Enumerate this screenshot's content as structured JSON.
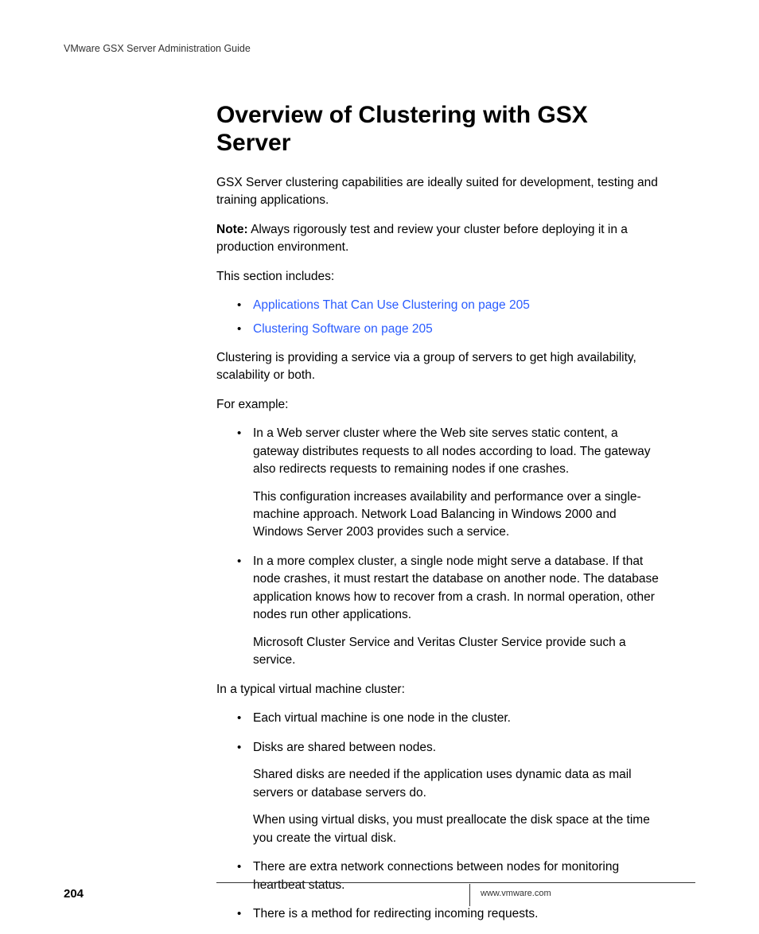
{
  "header": {
    "doc_title": "VMware GSX Server Administration Guide"
  },
  "main": {
    "heading": "Overview of Clustering with GSX Server",
    "intro": "GSX Server clustering capabilities are ideally suited for development, testing and training applications.",
    "note_label": "Note:",
    "note_text": "Always rigorously test and review your cluster before deploying it in a production environment.",
    "section_includes": "This section includes:",
    "links": [
      "Applications That Can Use Clustering on page 205",
      "Clustering Software on page 205"
    ],
    "clustering_def": "Clustering is providing a service via a group of servers to get high availability, scalability or both.",
    "for_example": "For example:",
    "examples": [
      {
        "main": "In a Web server cluster where the Web site serves static content, a gateway distributes requests to all nodes according to load. The gateway also redirects requests to remaining nodes if one crashes.",
        "sub": "This configuration increases availability and performance over a single-machine approach. Network Load Balancing in Windows 2000 and Windows Server 2003 provides such a service."
      },
      {
        "main": "In a more complex cluster, a single node might serve a database. If that node crashes, it must restart the database on another node. The database application knows how to recover from a crash. In normal operation, other nodes run other applications.",
        "sub": "Microsoft Cluster Service and Veritas Cluster Service provide such a service."
      }
    ],
    "typical_intro": "In a typical virtual machine cluster:",
    "typical_items": [
      {
        "main": "Each virtual machine is one node in the cluster."
      },
      {
        "main": "Disks are shared between nodes.",
        "sub1": "Shared disks are needed if the application uses dynamic data as mail servers or database servers do.",
        "sub2": "When using virtual disks, you must preallocate the disk space at the time you create the virtual disk."
      },
      {
        "main": "There are extra network connections between nodes for monitoring heartbeat status."
      },
      {
        "main": "There is a method for redirecting incoming requests."
      }
    ]
  },
  "footer": {
    "page_number": "204",
    "url": "www.vmware.com"
  }
}
